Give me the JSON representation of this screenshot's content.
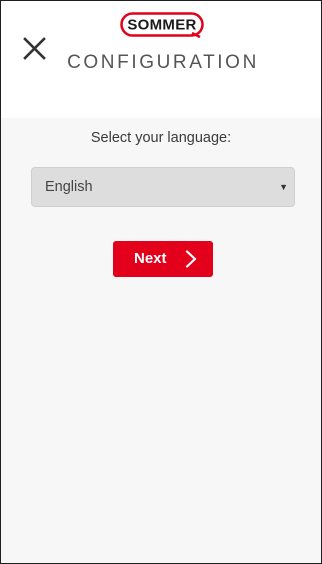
{
  "header": {
    "logo_text": "SOMMER",
    "title": "CONFIGURATION"
  },
  "main": {
    "prompt": "Select your language:",
    "language_select": {
      "selected": "English"
    },
    "next_label": "Next"
  },
  "icons": {
    "close": "close-icon",
    "dropdown": "caret-down-icon",
    "next": "chevron-right-icon"
  },
  "colors": {
    "brand_red": "#e3001b",
    "content_background": "#f7f7f7",
    "select_background": "#dddddd"
  }
}
